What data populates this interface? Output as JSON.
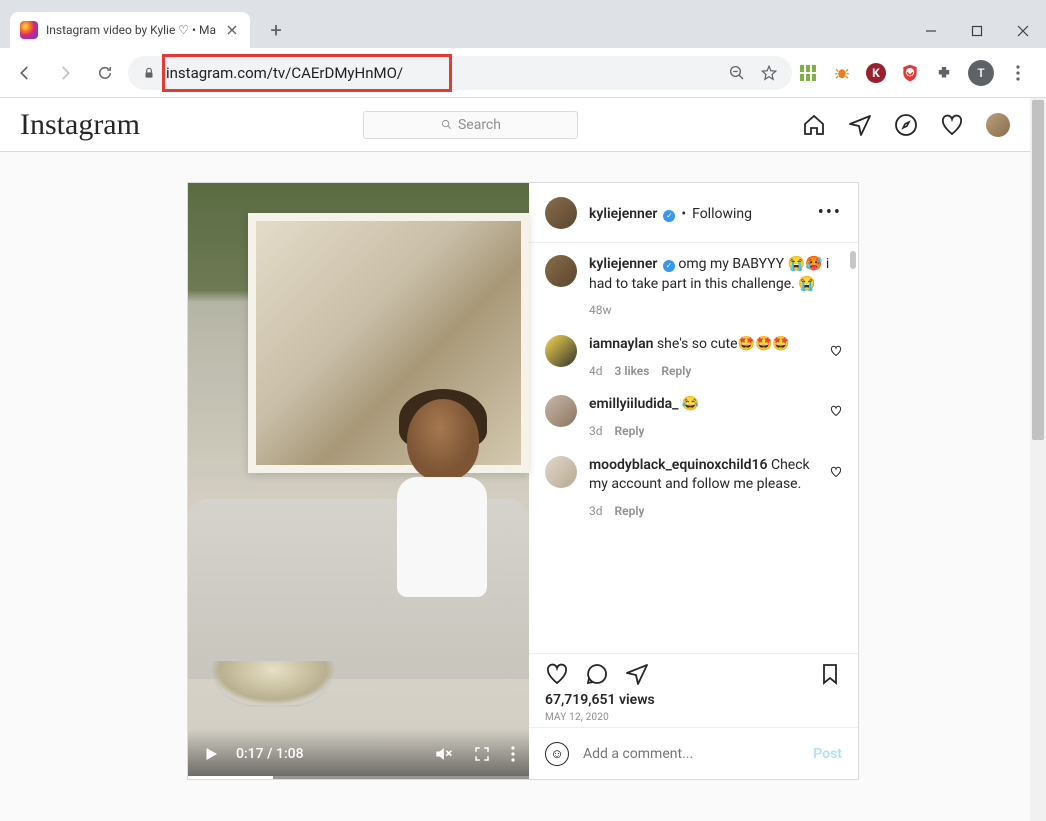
{
  "browser": {
    "tab_title": "Instagram video by Kylie ♡ • Ma",
    "url": "instagram.com/tv/CAErDMyHnMO/",
    "nav": {
      "back": "←",
      "forward": "→",
      "reload": "⟳"
    },
    "extensions": {
      "grid_icon": "grid",
      "bug_icon": "bug",
      "k_icon": "K",
      "ublock_icon": "ublock",
      "puzzle_icon": "extensions",
      "profile_letter": "T",
      "menu": "⋮"
    }
  },
  "instagram": {
    "logo": "Instagram",
    "search_placeholder": "Search",
    "nav_icons": [
      "home",
      "messages",
      "explore",
      "activity",
      "profile"
    ]
  },
  "post": {
    "header": {
      "username": "kyliejenner",
      "verified": true,
      "follow_status": "Following",
      "separator": "•"
    },
    "caption": {
      "username": "kyliejenner",
      "verified": true,
      "text": " omg my BABYYY 😭🥵 i had to take part in this challenge. 😭",
      "age": "48w"
    },
    "comments": [
      {
        "username": "iamnaylan",
        "text": " she's so cute🤩🤩🤩",
        "age": "4d",
        "likes": "3 likes",
        "reply": "Reply",
        "avatar_bg": "linear-gradient(135deg,#f7d94c,#333)"
      },
      {
        "username": "emillyiiludida_",
        "text": "  😂",
        "age": "3d",
        "likes": "",
        "reply": "Reply",
        "avatar_bg": "linear-gradient(135deg,#c9b8a8,#8a7560)"
      },
      {
        "username": "moodyblack_equinoxchild16",
        "text": " Check my account and follow me please.",
        "age": "3d",
        "likes": "",
        "reply": "Reply",
        "avatar_bg": "linear-gradient(135deg,#e0d8cc,#b8a890)"
      }
    ],
    "video": {
      "current_time": "0:17",
      "duration": "1:08",
      "time_display": "0:17 / 1:08"
    },
    "stats": {
      "views": "67,719,651 views",
      "date": "May 12, 2020"
    },
    "add_comment": {
      "placeholder": "Add a comment...",
      "post_label": "Post"
    }
  }
}
